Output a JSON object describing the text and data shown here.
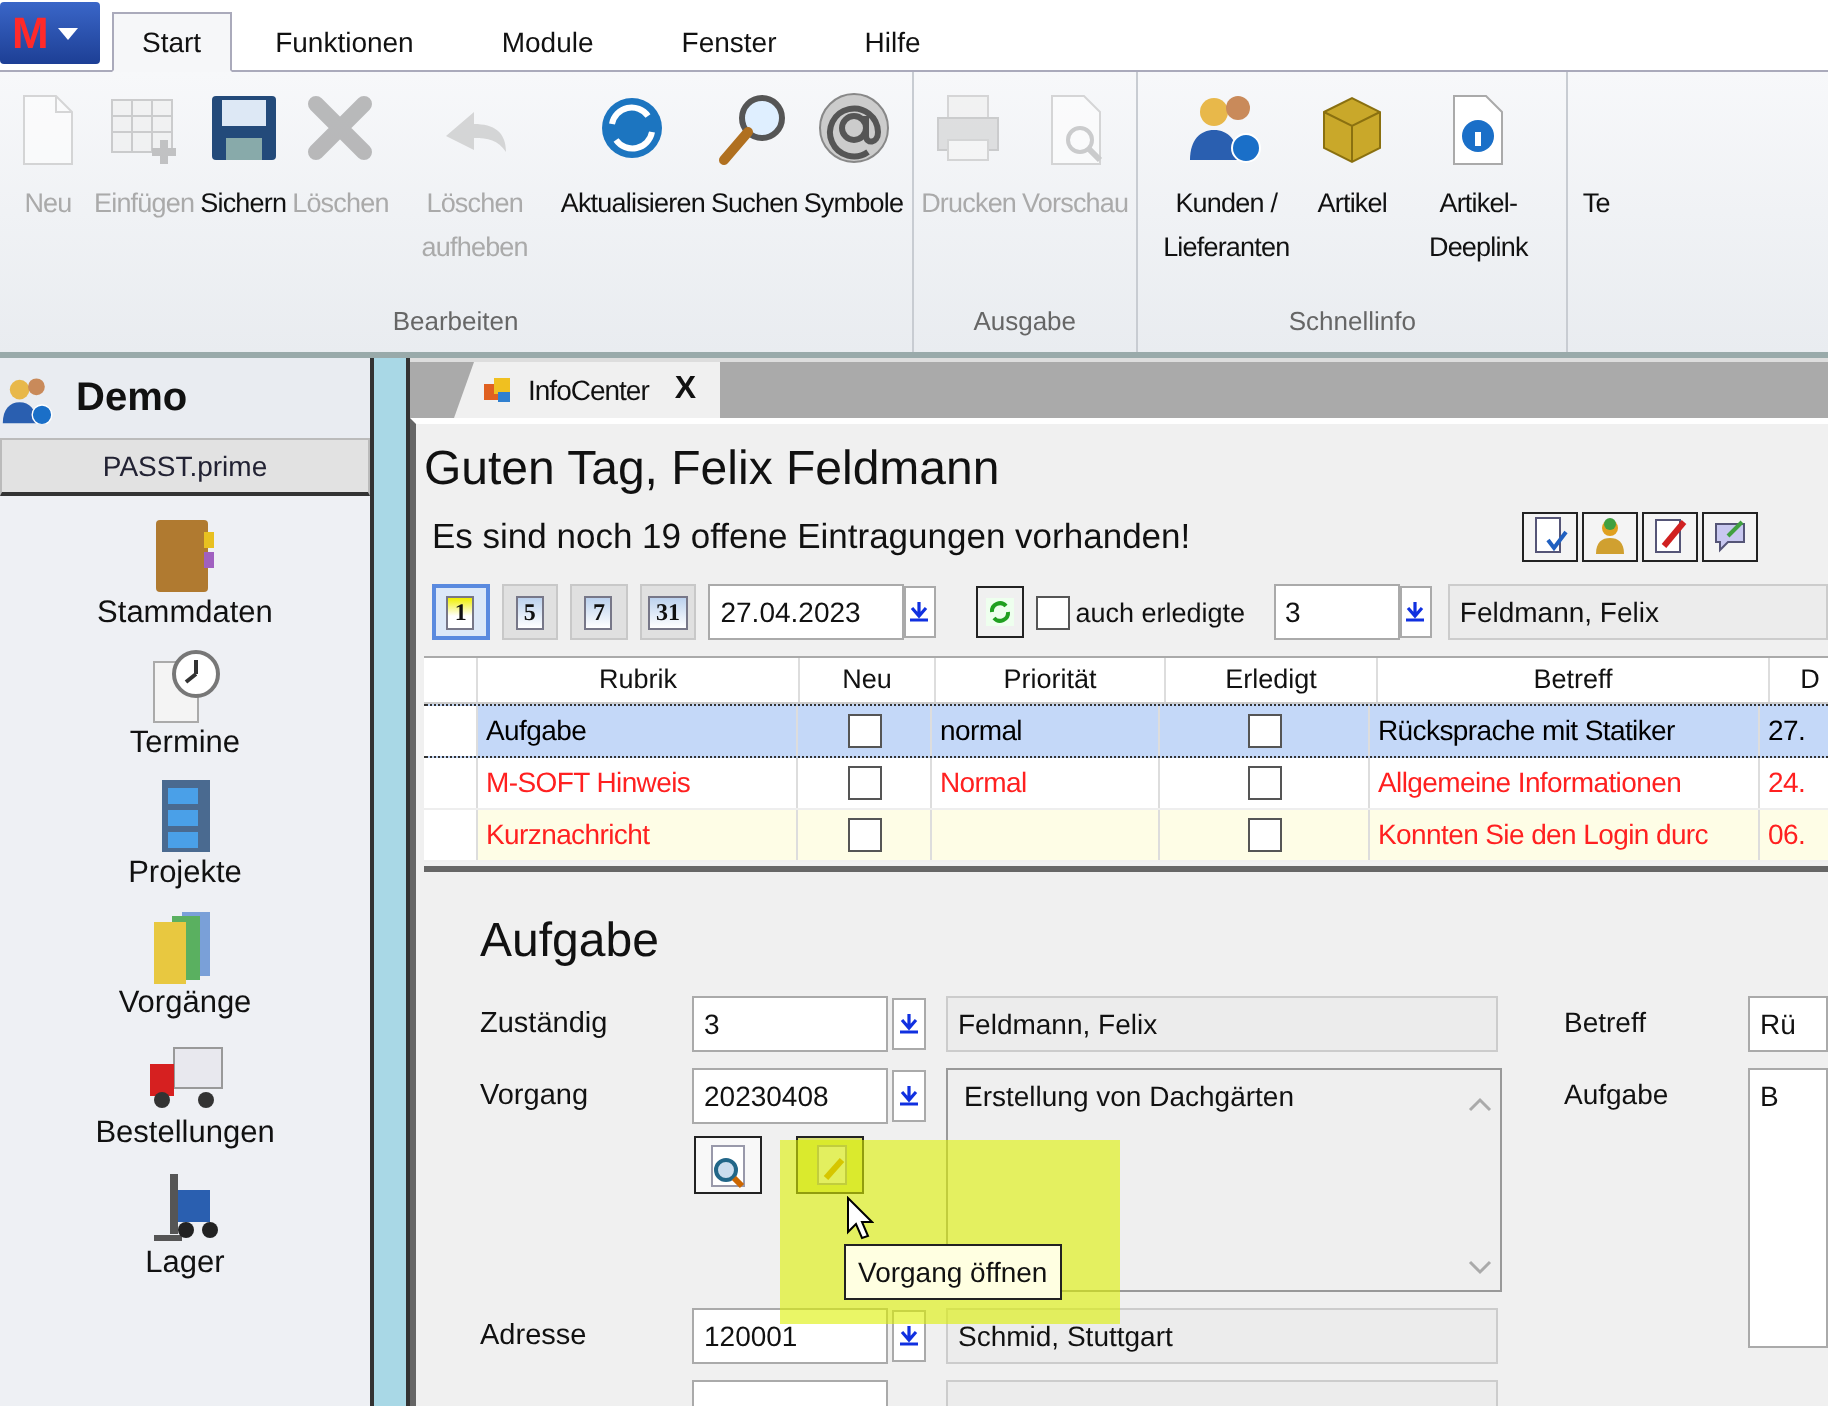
{
  "app_button": {
    "label": "M"
  },
  "menu_tabs": [
    {
      "label": "Start",
      "selected": true
    },
    {
      "label": "Funktionen",
      "selected": false
    },
    {
      "label": "Module",
      "selected": false
    },
    {
      "label": "Fenster",
      "selected": false
    },
    {
      "label": "Hilfe",
      "selected": false
    }
  ],
  "ribbon": {
    "groups": [
      {
        "label": "Bearbeiten",
        "buttons": [
          {
            "label": "Neu",
            "disabled": true
          },
          {
            "label": "Einfügen",
            "disabled": true
          },
          {
            "label": "Sichern",
            "disabled": false
          },
          {
            "label": "Löschen",
            "disabled": true
          },
          {
            "label": "Löschen aufheben",
            "disabled": true
          },
          {
            "label": "Aktualisieren",
            "disabled": false
          },
          {
            "label": "Suchen",
            "disabled": false
          },
          {
            "label": "Symbole",
            "disabled": false
          }
        ]
      },
      {
        "label": "Ausgabe",
        "buttons": [
          {
            "label": "Drucken",
            "disabled": true
          },
          {
            "label": "Vorschau",
            "disabled": true
          }
        ]
      },
      {
        "label": "Schnellinfo",
        "buttons": [
          {
            "label": "Kunden / Lieferanten",
            "disabled": false
          },
          {
            "label": "Artikel",
            "disabled": false
          },
          {
            "label": "Artikel-Deeplink",
            "disabled": false
          }
        ]
      }
    ],
    "cut_button": {
      "label": "Te"
    }
  },
  "sidebar": {
    "title": "Demo",
    "subtitle": "PASST.prime",
    "items": [
      "Stammdaten",
      "Termine",
      "Projekte",
      "Vorgänge",
      "Bestellungen",
      "Lager"
    ]
  },
  "document_tab": {
    "label": "InfoCenter",
    "close": "X"
  },
  "greeting": "Guten Tag, Felix Feldmann",
  "open_entries": "Es sind noch 19 offene Eintragungen vorhanden!",
  "toolbar": {
    "views": [
      {
        "label": "1",
        "selected": true
      },
      {
        "label": "5",
        "selected": false
      },
      {
        "label": "7",
        "selected": false
      },
      {
        "label": "31",
        "selected": false
      }
    ],
    "date": "27.04.2023",
    "show_done": {
      "label": "auch erledigte",
      "checked": false
    },
    "user_id": "3",
    "user_name": "Feldmann, Felix"
  },
  "table": {
    "columns": [
      "Rubrik",
      "Neu",
      "Priorität",
      "Erledigt",
      "Betreff",
      "D"
    ],
    "rows": [
      {
        "rubrik": "Aufgabe",
        "neu": false,
        "prioritaet": "normal",
        "erledigt": false,
        "betreff": "Rücksprache mit Statiker",
        "column_6": "27.",
        "selected": true,
        "tinted": false,
        "color": "#000000"
      },
      {
        "rubrik": "M-SOFT Hinweis",
        "neu": false,
        "prioritaet": "Normal",
        "erledigt": false,
        "betreff": "Allgemeine Informationen",
        "column_6": "24.",
        "selected": false,
        "tinted": false,
        "color": "#ff2020"
      },
      {
        "rubrik": "Kurznachricht",
        "neu": false,
        "prioritaet": "",
        "erledigt": false,
        "betreff": "Konnten Sie den Login durc",
        "column_6": "06.",
        "selected": false,
        "tinted": true,
        "color": "#ff2020"
      }
    ]
  },
  "detail": {
    "title": "Aufgabe",
    "zustaendig": {
      "label": "Zuständig",
      "value": "3",
      "name": "Feldmann, Felix"
    },
    "vorgang": {
      "label": "Vorgang",
      "value": "20230408",
      "text": "Erstellung von Dachgärten"
    },
    "adresse": {
      "label": "Adresse",
      "value": "120001",
      "name": "Schmid, Stuttgart"
    },
    "betreff": {
      "label": "Betreff",
      "value": "Rü"
    },
    "aufgabe": {
      "label": "Aufgabe",
      "value": "B"
    },
    "tooltip": "Vorgang öffnen"
  }
}
